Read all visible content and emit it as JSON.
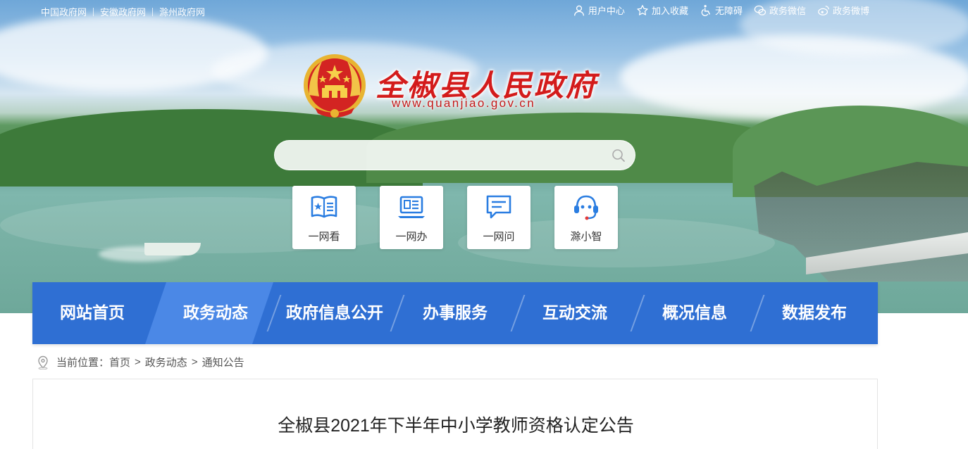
{
  "top_links": [
    "中国政府网",
    "安徽政府网",
    "滁州政府网"
  ],
  "top_right": [
    {
      "label": "用户中心",
      "icon": "user-icon"
    },
    {
      "label": "加入收藏",
      "icon": "star-icon"
    },
    {
      "label": "无障碍",
      "icon": "accessibility-icon"
    },
    {
      "label": "政务微信",
      "icon": "wechat-icon"
    },
    {
      "label": "政务微博",
      "icon": "weibo-icon"
    }
  ],
  "site": {
    "title": "全椒县人民政府",
    "url": "www.quanjiao.gov.cn"
  },
  "search": {
    "placeholder": "",
    "value": ""
  },
  "quick_links": [
    {
      "label": "一网看",
      "icon": "book-icon"
    },
    {
      "label": "一网办",
      "icon": "laptop-icon"
    },
    {
      "label": "一网问",
      "icon": "chat-icon"
    },
    {
      "label": "滁小智",
      "icon": "robot-headset-icon"
    }
  ],
  "nav": {
    "items": [
      "网站首页",
      "政务动态",
      "政府信息公开",
      "办事服务",
      "互动交流",
      "概况信息",
      "数据发布"
    ],
    "active": "政务动态"
  },
  "breadcrumb": {
    "prefix": "当前位置：",
    "items": [
      "首页",
      "政务动态",
      "通知公告"
    ],
    "separator": ">"
  },
  "article": {
    "title": "全椒县2021年下半年中小学教师资格认定公告"
  },
  "colors": {
    "nav_bg": "#2f6fd3",
    "nav_active": "#4b88e6",
    "title_red": "#d31b1b",
    "icon_blue": "#2a7de1"
  }
}
